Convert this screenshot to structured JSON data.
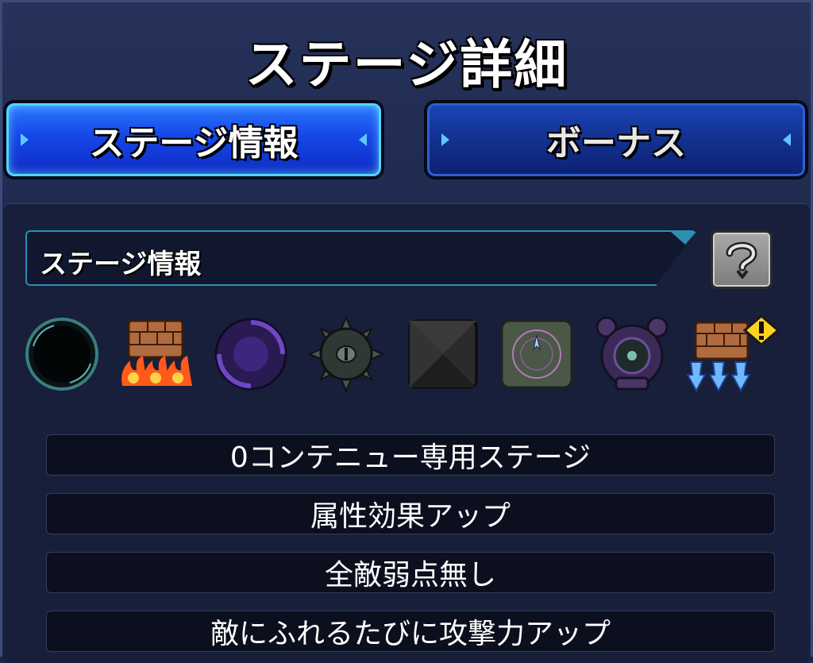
{
  "header": {
    "title": "ステージ詳細"
  },
  "tabs": [
    {
      "label": "ステージ情報",
      "active": true
    },
    {
      "label": "ボーナス",
      "active": false
    }
  ],
  "section": {
    "label": "ステージ情報",
    "help_icon": "question-icon"
  },
  "gimmicks": [
    {
      "icon": "black-hole-icon"
    },
    {
      "icon": "damage-wall-fire-icon"
    },
    {
      "icon": "warp-icon"
    },
    {
      "icon": "mine-icon"
    },
    {
      "icon": "block-icon"
    },
    {
      "icon": "magic-circle-icon"
    },
    {
      "icon": "shield-generator-icon"
    },
    {
      "icon": "damage-wall-down-icon",
      "badge": "!"
    }
  ],
  "info_lines": [
    "0コンテニュー専用ステージ",
    "属性効果アップ",
    "全敵弱点無し",
    "敵にふれるたびに攻撃力アップ"
  ],
  "colors": {
    "accent": "#1646e8",
    "panel": "#171f3a",
    "background": "#202b50"
  }
}
